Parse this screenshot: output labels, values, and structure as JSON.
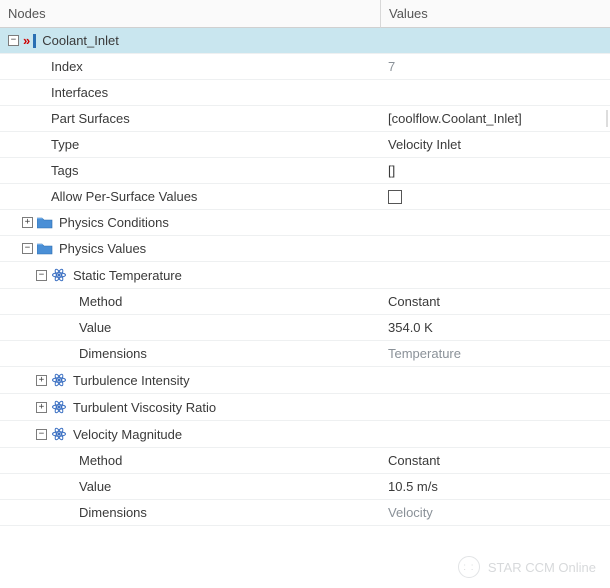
{
  "header": {
    "nodes": "Nodes",
    "values": "Values"
  },
  "rows": [
    {
      "id": "coolant-inlet",
      "indent": 0,
      "expander": "-",
      "iconType": "inlet",
      "label": "Coolant_Inlet",
      "value": "",
      "selected": true,
      "interact": true
    },
    {
      "id": "index",
      "indent": 2,
      "label": "Index",
      "value": "7",
      "greyVal": true,
      "interact": true
    },
    {
      "id": "interfaces",
      "indent": 2,
      "label": "Interfaces",
      "value": "",
      "interact": true
    },
    {
      "id": "part-surfaces",
      "indent": 2,
      "label": "Part Surfaces",
      "value": "[coolflow.Coolant_Inlet]",
      "interact": true,
      "rightEdge": true
    },
    {
      "id": "type",
      "indent": 2,
      "label": "Type",
      "value": "Velocity Inlet",
      "interact": true
    },
    {
      "id": "tags",
      "indent": 2,
      "label": "Tags",
      "value": "[]",
      "interact": true
    },
    {
      "id": "allow-per-surface",
      "indent": 2,
      "label": "Allow Per-Surface Values",
      "valueType": "checkbox",
      "interact": true
    },
    {
      "id": "physics-conditions",
      "indent": 1,
      "expander": "+",
      "iconType": "folder",
      "label": "Physics Conditions",
      "value": "",
      "interact": true
    },
    {
      "id": "physics-values",
      "indent": 1,
      "expander": "-",
      "iconType": "folder",
      "label": "Physics Values",
      "value": "",
      "interact": true
    },
    {
      "id": "static-temperature",
      "indent": 2,
      "expander": "-",
      "iconType": "atom",
      "label": "Static Temperature",
      "value": "",
      "interact": true
    },
    {
      "id": "st-method",
      "indent": 4,
      "label": "Method",
      "value": "Constant",
      "interact": true
    },
    {
      "id": "st-value",
      "indent": 4,
      "label": "Value",
      "value": "354.0 K",
      "interact": true
    },
    {
      "id": "st-dimensions",
      "indent": 4,
      "label": "Dimensions",
      "value": "Temperature",
      "greyVal": true,
      "interact": true
    },
    {
      "id": "turbulence-intensity",
      "indent": 2,
      "expander": "+",
      "iconType": "atom",
      "label": "Turbulence Intensity",
      "value": "",
      "interact": true
    },
    {
      "id": "turbulent-viscosity-ratio",
      "indent": 2,
      "expander": "+",
      "iconType": "atom",
      "label": "Turbulent Viscosity Ratio",
      "value": "",
      "interact": true
    },
    {
      "id": "velocity-magnitude",
      "indent": 2,
      "expander": "-",
      "iconType": "atom",
      "label": "Velocity Magnitude",
      "value": "",
      "interact": true
    },
    {
      "id": "vm-method",
      "indent": 4,
      "label": "Method",
      "value": "Constant",
      "interact": true
    },
    {
      "id": "vm-value",
      "indent": 4,
      "label": "Value",
      "value": "10.5 m/s",
      "interact": true
    },
    {
      "id": "vm-dimensions",
      "indent": 4,
      "label": "Dimensions",
      "value": "Velocity",
      "greyVal": true,
      "interact": true
    }
  ],
  "watermark": "STAR CCM Online"
}
